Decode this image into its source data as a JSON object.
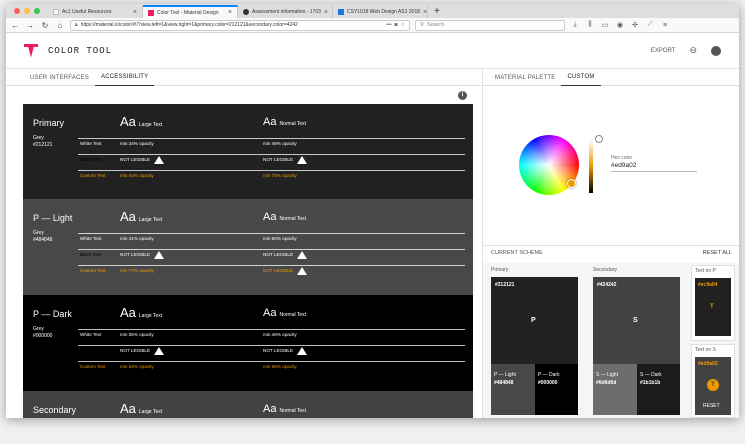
{
  "browser": {
    "tabs": [
      {
        "label": "Ac1 Useful Resources",
        "active": false
      },
      {
        "label": "Color Tool - Material Design",
        "active": true
      },
      {
        "label": "Assessment information - 1703",
        "active": false
      },
      {
        "label": "CSY1018 Web Design AS1 2018",
        "active": false
      }
    ],
    "url": "https://material.io/color/#!/?view.left=1&view.right=1&primary.color=212121&secondary.color=4242",
    "url_domain": "material.io",
    "search_placeholder": "Search"
  },
  "app": {
    "title": "COLOR TOOL",
    "export_label": "EXPORT"
  },
  "left_tabs": [
    "USER INTERFACES",
    "ACCESSIBILITY"
  ],
  "blocks": [
    {
      "name": "Primary",
      "desc1": "Grey",
      "desc2": "#212121",
      "bg": "#212121",
      "aa1": "Aa",
      "aa1_sub": "Large Text",
      "aa2": "Aa",
      "aa2_sub": "Normal Text",
      "rows": [
        {
          "label": "White Text",
          "c1": "min 34% opacity",
          "c2": "min 46% opacity",
          "warn1": false,
          "warn2": false,
          "orange": false
        },
        {
          "label": "Black Text",
          "c1": "NOT LEGIBLE",
          "c2": "NOT LEGIBLE",
          "warn1": true,
          "warn2": true,
          "orange": false
        },
        {
          "label": "Custom Text",
          "c1": "min 54% opacity",
          "c2": "min 75% opacity",
          "warn1": false,
          "warn2": false,
          "orange": true
        }
      ]
    },
    {
      "name": "P — Light",
      "desc1": "Grey",
      "desc2": "#484848",
      "bg": "#484848",
      "aa1": "Aa",
      "aa1_sub": "Large Text",
      "aa2": "Aa",
      "aa2_sub": "Normal Text",
      "rows": [
        {
          "label": "White Text",
          "c1": "min 41% opacity",
          "c2": "min 60% opacity",
          "warn1": false,
          "warn2": false,
          "orange": false
        },
        {
          "label": "Black Text",
          "c1": "NOT LEGIBLE",
          "c2": "NOT LEGIBLE",
          "warn1": true,
          "warn2": true,
          "orange": false
        },
        {
          "label": "Custom Text",
          "c1": "min 77% opacity",
          "c2": "NOT LEGIBLE",
          "warn1": false,
          "warn2": true,
          "orange": true
        }
      ]
    },
    {
      "name": "P — Dark",
      "desc1": "Grey",
      "desc2": "#000000",
      "bg": "#000000",
      "aa1": "Aa",
      "aa1_sub": "Large Text",
      "aa2": "Aa",
      "aa2_sub": "Normal Text",
      "rows": [
        {
          "label": "White Text",
          "c1": "min 35% opacity",
          "c2": "min 46% opacity",
          "warn1": false,
          "warn2": false,
          "orange": false
        },
        {
          "label": "Black Text",
          "c1": "NOT LEGIBLE",
          "c2": "NOT LEGIBLE",
          "warn1": true,
          "warn2": true,
          "orange": false
        },
        {
          "label": "Custom Text",
          "c1": "min 52% opacity",
          "c2": "min 68% opacity",
          "warn1": false,
          "warn2": false,
          "orange": true
        }
      ]
    },
    {
      "name": "Secondary",
      "desc1": "",
      "desc2": "",
      "bg": "#424242",
      "aa1": "Aa",
      "aa1_sub": "Large Text",
      "aa2": "Aa",
      "aa2_sub": "Normal Text",
      "rows": []
    }
  ],
  "right_tabs": [
    "MATERIAL PALETTE",
    "CUSTOM"
  ],
  "custom": {
    "hex_label": "Hex color",
    "hex_value": "#ed9a02"
  },
  "scheme": {
    "title": "CURRENT SCHEME",
    "reset_all": "RESET ALL",
    "primary": {
      "title": "Primary",
      "hex": "#212121",
      "letter": "P",
      "light_label": "P — Light",
      "light_hex": "#484848",
      "dark_label": "P — Dark",
      "dark_hex": "#000000"
    },
    "secondary": {
      "title": "Secondary",
      "hex": "#424242",
      "letter": "S",
      "light_label": "S — Light",
      "light_hex": "#6d6d6d",
      "dark_label": "S — Dark",
      "dark_hex": "#1b1b1b"
    },
    "text_on_p": {
      "title": "Text on P",
      "hex": "#ec9a04",
      "letter": "T"
    },
    "text_on_s": {
      "title": "Text on S",
      "hex": "#ed9a02",
      "letter": "T",
      "reset": "RESET"
    }
  },
  "colors": {
    "accent": "#ed9a02",
    "brand": "#e91e63"
  }
}
